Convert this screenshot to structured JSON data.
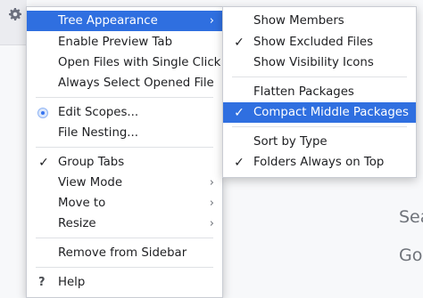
{
  "background": {
    "hints": [
      "Sea",
      "Go"
    ]
  },
  "colors": {
    "selection": "#2f6fe0",
    "menu_background": "#ffffff",
    "check": "#1e1f22",
    "radio_accent": "#3574f0"
  },
  "main_menu": {
    "items": [
      {
        "label": "Tree Appearance",
        "submenu": true,
        "selected": true
      },
      {
        "label": "Enable Preview Tab"
      },
      {
        "label": "Open Files with Single Click"
      },
      {
        "label": "Always Select Opened File"
      },
      {
        "label": "Edit Scopes...",
        "icon": "scope-radio-icon"
      },
      {
        "label": "File Nesting..."
      },
      {
        "label": "Group Tabs",
        "checked": true
      },
      {
        "label": "View Mode",
        "submenu": true
      },
      {
        "label": "Move to",
        "submenu": true
      },
      {
        "label": "Resize",
        "submenu": true
      },
      {
        "label": "Remove from Sidebar"
      },
      {
        "label": "Help",
        "icon": "help-icon"
      }
    ],
    "check_glyph": "✓",
    "arrow_glyph": "›",
    "help_glyph": "?"
  },
  "tree_appearance_submenu": {
    "items": [
      {
        "label": "Show Members",
        "checked": false
      },
      {
        "label": "Show Excluded Files",
        "checked": true
      },
      {
        "label": "Show Visibility Icons",
        "checked": false
      },
      {
        "label": "Flatten Packages",
        "checked": false
      },
      {
        "label": "Compact Middle Packages",
        "checked": true,
        "selected": true
      },
      {
        "label": "Sort by Type",
        "checked": false
      },
      {
        "label": "Folders Always on Top",
        "checked": true
      }
    ],
    "check_glyph": "✓"
  }
}
